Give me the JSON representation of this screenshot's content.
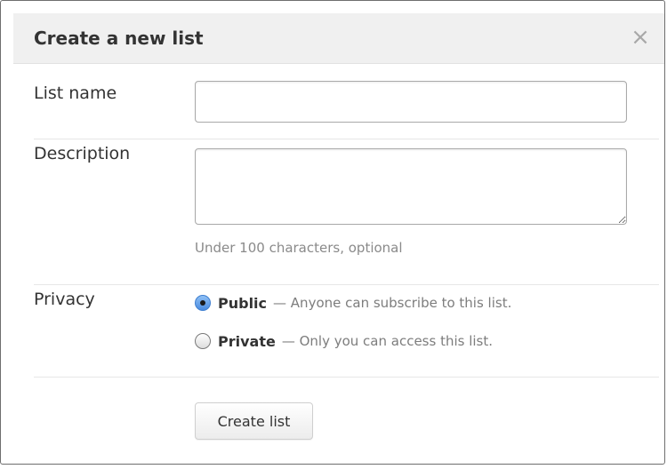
{
  "dialog": {
    "title": "Create a new list",
    "close_icon": "close-icon",
    "close_glyph": "×"
  },
  "form": {
    "list_name": {
      "label": "List name",
      "value": "",
      "placeholder": ""
    },
    "description": {
      "label": "Description",
      "value": "",
      "placeholder": "",
      "hint": "Under 100 characters, optional"
    },
    "privacy": {
      "label": "Privacy",
      "selected": "public",
      "options": [
        {
          "value": "public",
          "name": "Public",
          "description": "— Anyone can subscribe to this list.",
          "checked": true
        },
        {
          "value": "private",
          "name": "Private",
          "description": "— Only you can access this list.",
          "checked": false
        }
      ]
    },
    "submit_label": "Create list"
  },
  "colors": {
    "header_bg": "#f0f0f0",
    "text": "#333333",
    "muted_text": "#8a8a8a",
    "radio_selected": "#4a8be0"
  }
}
